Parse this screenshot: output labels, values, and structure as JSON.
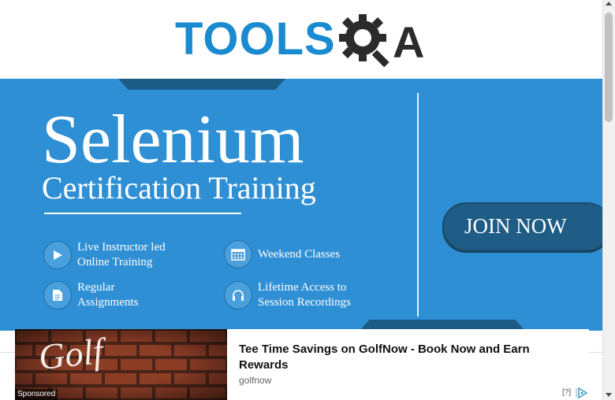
{
  "header": {
    "logo_text": "TOOLS",
    "logo_letter": "A"
  },
  "banner": {
    "title": "Selenium",
    "subtitle": "Certification Training",
    "features": [
      {
        "label": "Live Instructor led Online Training",
        "icon": "play-icon"
      },
      {
        "label": "Weekend Classes",
        "icon": "calendar-icon"
      },
      {
        "label": "Regular Assignments",
        "icon": "document-icon"
      },
      {
        "label": "Lifetime Access to Session Recordings",
        "icon": "headphones-icon"
      }
    ],
    "join_label": "JOIN NOW"
  },
  "ad": {
    "image_text": "Golf",
    "sponsored": "Sponsored",
    "headline": "Tee Time Savings on GolfNow - Book Now and Earn Rewards",
    "source": "golfnow",
    "info": "[?]"
  },
  "colors": {
    "banner_bg": "#2f8fd4",
    "accent_dark": "#1f5d86",
    "logo_blue": "#1a8bd0"
  }
}
